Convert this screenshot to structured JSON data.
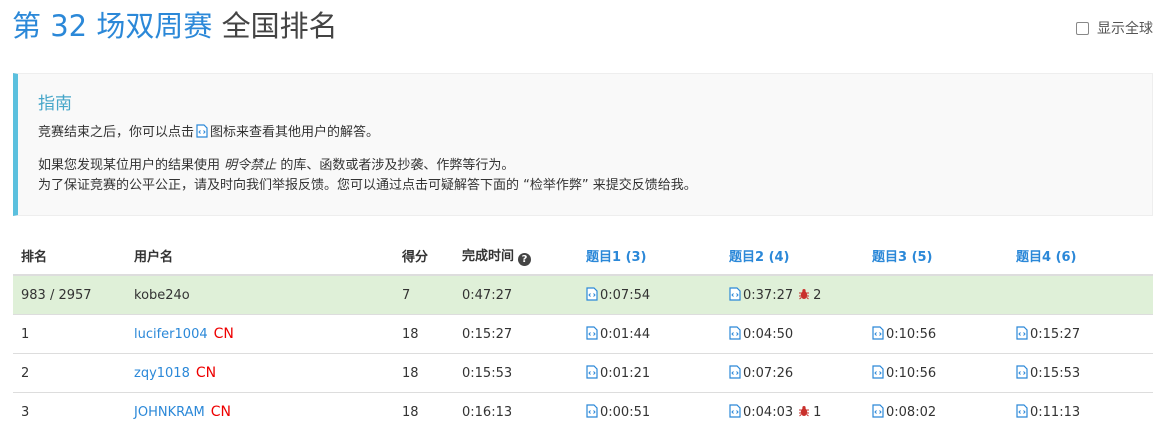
{
  "header": {
    "title_prefix": "第 32 场双周赛",
    "title_suffix": "全国排名",
    "show_global_label": "显示全球"
  },
  "guide": {
    "title": "指南",
    "line1_before": "竞赛结束之后，你可以点击",
    "line1_after": "图标来查看其他用户的解答。",
    "line2_before": "如果您发现某位用户的结果使用",
    "line2_em": "明令禁止",
    "line2_after": "的库、函数或者涉及抄袭、作弊等行为。",
    "line3": "为了保证竞赛的公平公正，请及时向我们举报反馈。您可以通过点击可疑解答下面的 “检举作弊” 来提交反馈给我。"
  },
  "table": {
    "headers": {
      "rank": "排名",
      "username": "用户名",
      "score": "得分",
      "finish_time": "完成时间",
      "q1": "题目1 (3)",
      "q2": "题目2 (4)",
      "q3": "题目3 (5)",
      "q4": "题目4 (6)"
    },
    "rows": [
      {
        "rank": "983 / 2957",
        "username": "kobe24o",
        "region": "",
        "score": "7",
        "finish_time": "0:47:27",
        "q1": "0:07:54",
        "q2": "0:37:27",
        "q2_bugs": "2",
        "q3": "",
        "q4": ""
      },
      {
        "rank": "1",
        "username": "lucifer1004",
        "region": "CN",
        "score": "18",
        "finish_time": "0:15:27",
        "q1": "0:01:44",
        "q2": "0:04:50",
        "q2_bugs": "",
        "q3": "0:10:56",
        "q4": "0:15:27"
      },
      {
        "rank": "2",
        "username": "zqy1018",
        "region": "CN",
        "score": "18",
        "finish_time": "0:15:53",
        "q1": "0:01:21",
        "q2": "0:07:26",
        "q2_bugs": "",
        "q3": "0:10:56",
        "q4": "0:15:53"
      },
      {
        "rank": "3",
        "username": "JOHNKRAM",
        "region": "CN",
        "score": "18",
        "finish_time": "0:16:13",
        "q1": "0:00:51",
        "q2": "0:04:03",
        "q2_bugs": "1",
        "q3": "0:08:02",
        "q4": "0:11:13"
      }
    ]
  },
  "icons": {
    "solution": "code-file-icon",
    "wrong_submission": "bug-icon",
    "help": "question-circle-icon"
  },
  "colors": {
    "accent": "#2b88d8",
    "own_row": "#dff0d8",
    "guide_border": "#5bc0de",
    "region": "#ee0000",
    "bug": "#c9302c"
  }
}
